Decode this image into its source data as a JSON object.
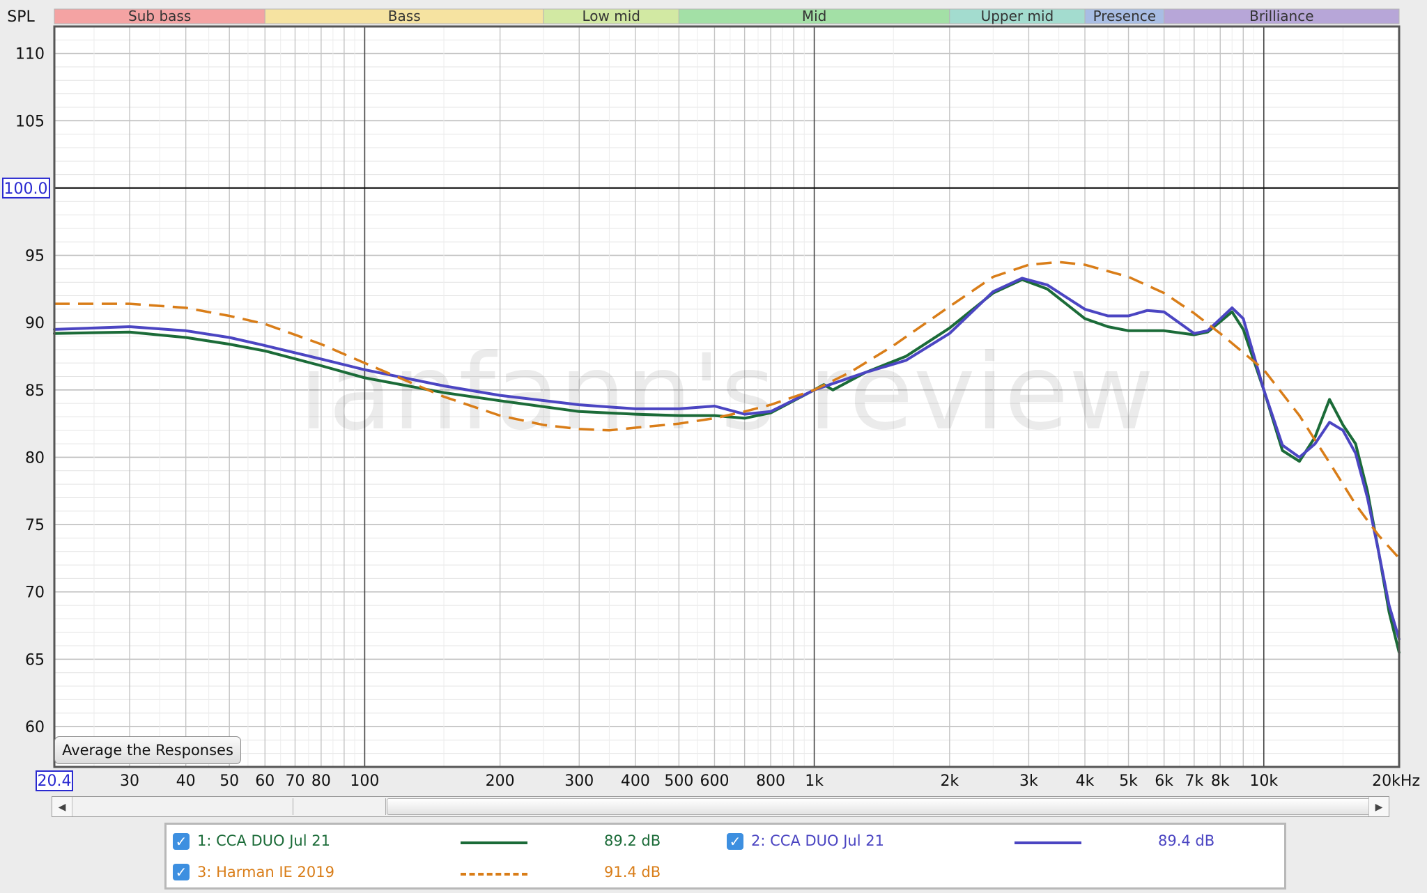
{
  "chart_data": {
    "type": "line",
    "ylabel": "SPL",
    "x_scale": "log",
    "xlim": [
      20.4,
      20000
    ],
    "ylim": [
      57,
      112
    ],
    "yticks": [
      110,
      105,
      100,
      95,
      90,
      85,
      80,
      75,
      70,
      65,
      60
    ],
    "xticks": [
      {
        "value": 30,
        "label": "30"
      },
      {
        "value": 40,
        "label": "40"
      },
      {
        "value": 50,
        "label": "50"
      },
      {
        "value": 60,
        "label": "60"
      },
      {
        "value": 70,
        "label": "70"
      },
      {
        "value": 80,
        "label": "80"
      },
      {
        "value": 100,
        "label": "100"
      },
      {
        "value": 200,
        "label": "200"
      },
      {
        "value": 300,
        "label": "300"
      },
      {
        "value": 400,
        "label": "400"
      },
      {
        "value": 500,
        "label": "500"
      },
      {
        "value": 600,
        "label": "600"
      },
      {
        "value": 800,
        "label": "800"
      },
      {
        "value": 1000,
        "label": "1k"
      },
      {
        "value": 2000,
        "label": "2k"
      },
      {
        "value": 3000,
        "label": "3k"
      },
      {
        "value": 4000,
        "label": "4k"
      },
      {
        "value": 5000,
        "label": "5k"
      },
      {
        "value": 6000,
        "label": "6k"
      },
      {
        "value": 7000,
        "label": "7k"
      },
      {
        "value": 8000,
        "label": "8k"
      },
      {
        "value": 10000,
        "label": "10k"
      },
      {
        "value": 20000,
        "label": "20kHz"
      }
    ],
    "x_min_label": "20.4",
    "reference_line": {
      "value": 100,
      "label": "100.0"
    },
    "bands": [
      {
        "name": "Sub bass",
        "from": 20.4,
        "to": 60,
        "color": "#f4a3a3"
      },
      {
        "name": "Bass",
        "from": 60,
        "to": 250,
        "color": "#f6e3a1"
      },
      {
        "name": "Low mid",
        "from": 250,
        "to": 500,
        "color": "#d2e9a3"
      },
      {
        "name": "Mid",
        "from": 500,
        "to": 2000,
        "color": "#a3e0a6"
      },
      {
        "name": "Upper mid",
        "from": 2000,
        "to": 4000,
        "color": "#a3dccf"
      },
      {
        "name": "Presence",
        "from": 4000,
        "to": 6000,
        "color": "#a8bde4"
      },
      {
        "name": "Brilliance",
        "from": 6000,
        "to": 20000,
        "color": "#b7a6d8"
      }
    ],
    "grid": true,
    "series": [
      {
        "name": "1: CCA DUO Jul 21",
        "color": "#1b6b38",
        "dash": false,
        "x": [
          20.4,
          30,
          40,
          50,
          60,
          80,
          100,
          150,
          200,
          300,
          400,
          500,
          600,
          700,
          800,
          1000,
          1050,
          1100,
          1300,
          1600,
          2000,
          2500,
          2900,
          3300,
          4000,
          4500,
          5000,
          6000,
          7000,
          7500,
          8500,
          9000,
          10000,
          11000,
          12000,
          13000,
          14000,
          15000,
          16000,
          17000,
          18000,
          19000,
          20000
        ],
        "y": [
          89.2,
          89.3,
          88.9,
          88.4,
          87.9,
          86.8,
          85.9,
          84.8,
          84.2,
          83.4,
          83.2,
          83.1,
          83.1,
          82.9,
          83.3,
          85.0,
          85.4,
          85.0,
          86.3,
          87.5,
          89.6,
          92.2,
          93.2,
          92.5,
          90.3,
          89.7,
          89.4,
          89.4,
          89.1,
          89.3,
          90.8,
          89.5,
          85.0,
          80.5,
          79.7,
          81.5,
          84.3,
          82.4,
          81.0,
          77.5,
          73.0,
          68.5,
          65.5
        ]
      },
      {
        "name": "2: CCA DUO Jul 21",
        "color": "#4b45c2",
        "dash": false,
        "x": [
          20.4,
          30,
          40,
          50,
          60,
          80,
          100,
          150,
          200,
          300,
          400,
          500,
          600,
          700,
          800,
          1000,
          1300,
          1600,
          2000,
          2500,
          2900,
          3300,
          4000,
          4500,
          5000,
          5500,
          6000,
          7000,
          7500,
          8500,
          9000,
          10000,
          11000,
          12000,
          13000,
          14000,
          15000,
          16000,
          17000,
          18000,
          19000,
          20000
        ],
        "y": [
          89.5,
          89.7,
          89.4,
          88.9,
          88.3,
          87.3,
          86.5,
          85.3,
          84.6,
          83.9,
          83.6,
          83.6,
          83.8,
          83.2,
          83.4,
          85.0,
          86.3,
          87.2,
          89.2,
          92.3,
          93.3,
          92.8,
          91.0,
          90.5,
          90.5,
          90.9,
          90.8,
          89.2,
          89.4,
          91.1,
          90.3,
          85.0,
          80.9,
          80.0,
          81.0,
          82.6,
          82.0,
          80.3,
          77.0,
          73.0,
          69.0,
          66.5
        ]
      },
      {
        "name": "3: Harman IE 2019",
        "color": "#d97d18",
        "dash": true,
        "x": [
          20.4,
          30,
          40,
          50,
          60,
          80,
          100,
          150,
          200,
          250,
          300,
          350,
          400,
          500,
          600,
          700,
          800,
          1000,
          1200,
          1500,
          2000,
          2500,
          3000,
          3500,
          4000,
          5000,
          6000,
          7000,
          8000,
          10000,
          12000,
          14000,
          16000,
          18000,
          20000
        ],
        "y": [
          91.4,
          91.4,
          91.1,
          90.5,
          89.9,
          88.4,
          87.0,
          84.5,
          83.1,
          82.4,
          82.1,
          82.0,
          82.2,
          82.5,
          82.9,
          83.4,
          83.9,
          85.0,
          86.3,
          88.3,
          91.2,
          93.4,
          94.3,
          94.5,
          94.3,
          93.4,
          92.2,
          90.7,
          89.2,
          86.5,
          83.1,
          79.6,
          76.5,
          74.2,
          72.5
        ]
      }
    ]
  },
  "watermark": "ianfann's review",
  "buttons": {
    "average": "Average the Responses"
  },
  "legend": {
    "items": [
      {
        "label": "1: CCA DUO Jul 21",
        "value": "89.2 dB",
        "color": "#1b6b38",
        "dash": false
      },
      {
        "label": "2: CCA DUO Jul 21",
        "value": "89.4 dB",
        "color": "#4b45c2",
        "dash": false
      },
      {
        "label": "3: Harman IE 2019",
        "value": "91.4 dB",
        "color": "#d97d18",
        "dash": true
      }
    ]
  },
  "scrollbar": {
    "left_arrow": "◀",
    "right_arrow": "▶"
  }
}
